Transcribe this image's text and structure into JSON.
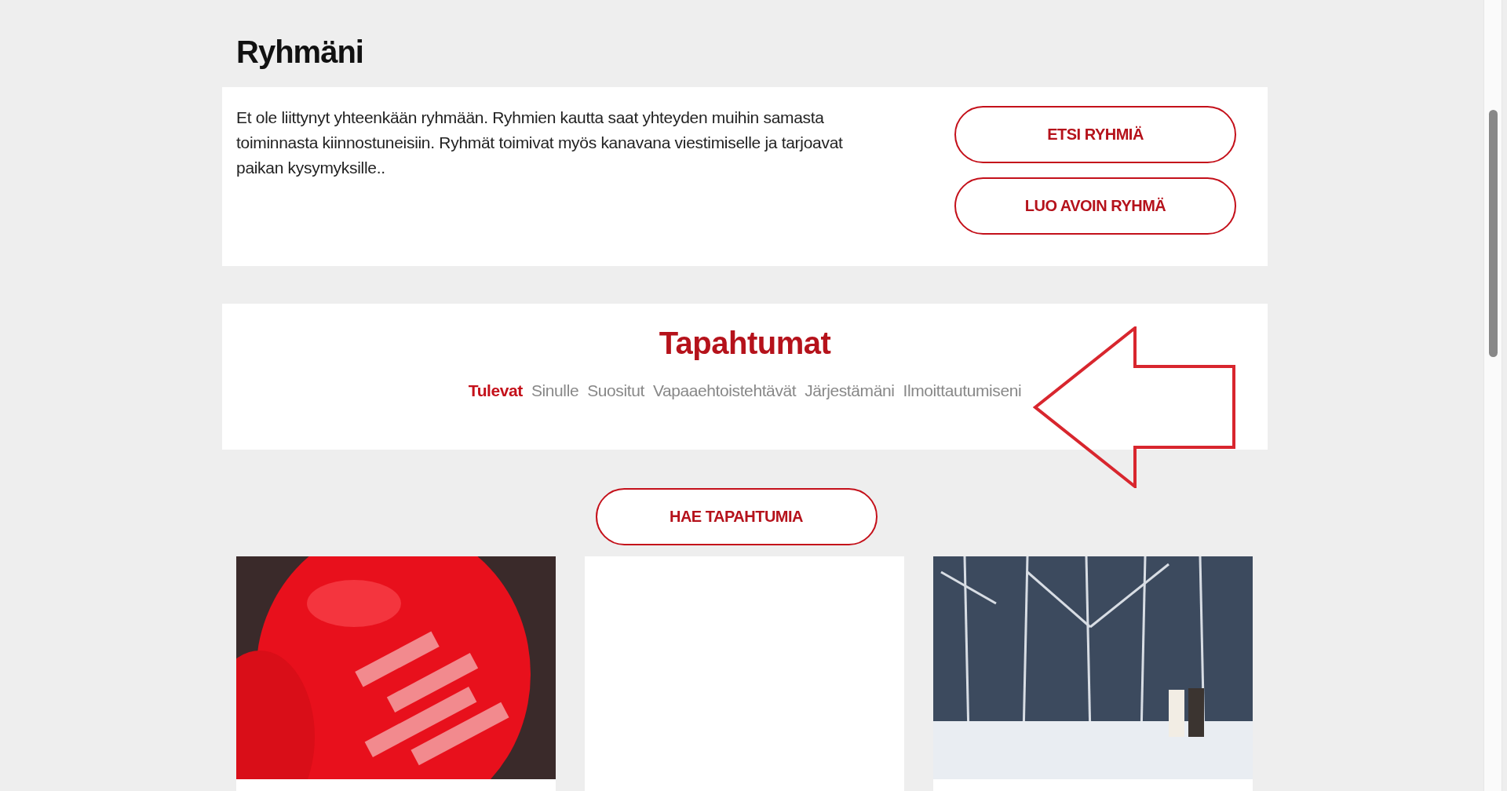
{
  "groups": {
    "title": "Ryhmäni",
    "text": "Et ole liittynyt yhteenkään ryhmään. Ryhmien kautta saat yhteyden muihin samasta toiminnasta kiinnostuneisiin. Ryhmät toimivat myös kanavana viestimiselle ja tarjoavat paikan kysymyksille..",
    "buttons": [
      "ETSI RYHMIÄ",
      "LUO AVOIN RYHMÄ"
    ]
  },
  "events": {
    "title": "Tapahtumat",
    "tabs": [
      {
        "label": "Tulevat",
        "selected": true
      },
      {
        "label": "Sinulle",
        "selected": false
      },
      {
        "label": "Suositut",
        "selected": false
      },
      {
        "label": "Vapaaehtoistehtävät",
        "selected": false
      },
      {
        "label": "Järjestämäni",
        "selected": false
      },
      {
        "label": "Ilmoittautumiseni",
        "selected": false
      }
    ],
    "search_button": "HAE TAPAHTUMIA",
    "cards": [
      {
        "kind": "balloons"
      },
      {
        "kind": "blank"
      },
      {
        "kind": "forest"
      }
    ]
  }
}
